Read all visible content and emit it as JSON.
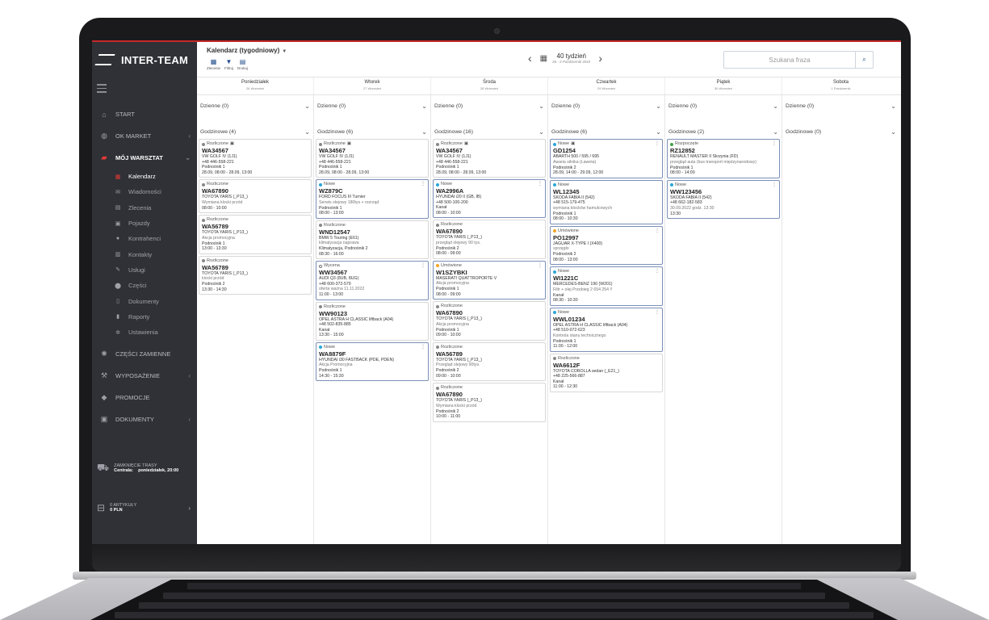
{
  "app": {
    "name": "INTER-TEAM"
  },
  "colors": {
    "accent": "#c62828",
    "sidebar_bg": "#2f3136",
    "primary": "#1e4b8a"
  },
  "sidebar": {
    "items": [
      {
        "label": "START",
        "icon": "home-icon"
      },
      {
        "label": "OK MARKET",
        "icon": "globe-icon"
      },
      {
        "label": "MÓJ WARSZTAT",
        "icon": "car-icon",
        "active": true
      }
    ],
    "sub_items": [
      {
        "label": "Kalendarz",
        "icon": "calendar-icon",
        "active": true
      },
      {
        "label": "Wiadomości",
        "icon": "mail-icon"
      },
      {
        "label": "Zlecenia",
        "icon": "clipboard-icon"
      },
      {
        "label": "Pojazdy",
        "icon": "vehicle-icon"
      },
      {
        "label": "Kontrahenci",
        "icon": "user-icon"
      },
      {
        "label": "Kontakty",
        "icon": "contact-icon"
      },
      {
        "label": "Usługi",
        "icon": "wrench-icon"
      },
      {
        "label": "Części",
        "icon": "part-icon"
      },
      {
        "label": "Dokumenty",
        "icon": "document-icon"
      },
      {
        "label": "Raporty",
        "icon": "chart-icon"
      },
      {
        "label": "Ustawienia",
        "icon": "gear-icon"
      }
    ],
    "bottom_items": [
      {
        "label": "CZĘŚCI ZAMIENNE",
        "icon": "parts-icon"
      },
      {
        "label": "WYPOSAŻENIE",
        "icon": "equipment-icon"
      },
      {
        "label": "PROMOCJE",
        "icon": "tag-icon"
      },
      {
        "label": "DOKUMENTY",
        "icon": "document-icon"
      }
    ],
    "route": {
      "title": "ZAMKNIĘCIE TRASY",
      "label": "Centrala:",
      "value": "poniedziałek, 20:00"
    },
    "cart": {
      "title": "0 ARTYKUŁY",
      "value": "0 PLN"
    }
  },
  "toolbar": {
    "title": "Kalendarz (tygodniowy)",
    "tools": [
      {
        "label": "Zlecenie"
      },
      {
        "label": "Filtruj"
      },
      {
        "label": "Drukuj"
      }
    ],
    "week": "40 tydzień",
    "range": "26 - 2 Październik 2022",
    "search_placeholder": "Szukana fraza"
  },
  "days": [
    {
      "name": "Poniedziałek",
      "date": "26 Wrzesień",
      "dzienne": "Dzienne (0)",
      "godzinowe": "Godzinowe (4)",
      "cards": [
        {
          "status": "Rozliczone",
          "dot": "#888888",
          "plate": "WA34567",
          "car": "VW GOLF IV (1J1)",
          "phone": "+48 446-558-221",
          "desc": "",
          "loc": "Podnośnik 1",
          "time": "28.09, 08:00 - 28.09, 13:00"
        },
        {
          "status": "Rozliczone",
          "dot": "#888888",
          "plate": "WA67890",
          "car": "TOYOTA YARIS (_P13_)",
          "phone": "",
          "desc": "Wymiana klocki przód",
          "loc": "",
          "time": "08:00 - 10:00"
        },
        {
          "status": "Rozliczone",
          "dot": "#888888",
          "plate": "WA56789",
          "car": "TOYOTA YARIS (_P13_)",
          "phone": "",
          "desc": "Akcja promocyjna",
          "loc": "Podnośnik 1",
          "time": "13:00 - 13:30"
        },
        {
          "status": "Rozliczone",
          "dot": "#888888",
          "plate": "WA56789",
          "car": "TOYOTA YARIS (_P13_)",
          "phone": "",
          "desc": "klocki przód",
          "loc": "Podnośnik 2",
          "time": "13:30 - 14:30"
        }
      ]
    },
    {
      "name": "Wtorek",
      "date": "27 Wrzesień",
      "dzienne": "Dzienne (0)",
      "godzinowe": "Godzinowe (6)",
      "cards": [
        {
          "status": "Rozliczone",
          "dot": "#888888",
          "plate": "WA34567",
          "car": "VW GOLF IV (1J1)",
          "phone": "+48 446-558-221",
          "desc": "",
          "loc": "Podnośnik 1",
          "time": "28.09, 08:00 - 28.09, 13:00"
        },
        {
          "status": "Nowe",
          "dot": "#29a7d8",
          "plate": "WZ879C",
          "car": "FORD FOCUS III Turnier",
          "phone": "",
          "desc": "Serwis olejowy 180tys + rozrząd",
          "loc": "Podnośnik 1",
          "time": "08:00 - 13:00",
          "menu": true
        },
        {
          "status": "Rozliczone",
          "dot": "#888888",
          "plate": "WND12547",
          "car": "BMW 5 Touring (E61)",
          "phone": "",
          "desc": "klimatyzacja naprawa",
          "loc": "Klimatyzacja, Podnośnik 2",
          "time": "08:30 - 16:00"
        },
        {
          "status": "Wycena",
          "dot": "#ffffff",
          "plate": "WW34567",
          "car": "AUDI Q3 (8UB, 8UG)",
          "phone": "+48 600-372-579",
          "desc": "oferta ważna 11.11.2022",
          "loc": "",
          "time": "11:00 - 13:00",
          "menu": true
        },
        {
          "status": "Rozliczone",
          "dot": "#888888",
          "plate": "WW90123",
          "car": "OPEL ASTRA H CLASSIC liftback (A04)",
          "phone": "+48 502-835-885",
          "desc": "",
          "loc": "Kanał",
          "time": "13:30 - 15:00"
        },
        {
          "status": "Nowe",
          "dot": "#29a7d8",
          "plate": "WA8879F",
          "car": "HYUNDAI i30 FASTBACK (PDE, PDEN)",
          "phone": "",
          "desc": "Akcja Promocyjna",
          "loc": "Podnośnik 1",
          "time": "14:30 - 15:30",
          "menu": true
        }
      ]
    },
    {
      "name": "Środa",
      "date": "28 Wrzesień",
      "dzienne": "Dzienne (0)",
      "godzinowe": "Godzinowe (16)",
      "cards": [
        {
          "status": "Rozliczone",
          "dot": "#888888",
          "plate": "WA34567",
          "car": "VW GOLF IV (1J1)",
          "phone": "+48 446-558-221",
          "desc": "",
          "loc": "Podnośnik 1",
          "time": "28.09, 08:00 - 28.09, 13:00"
        },
        {
          "status": "Nowe",
          "dot": "#29a7d8",
          "plate": "WA2996A",
          "car": "HYUNDAI i20 II (GB, IB)",
          "phone": "+48 500-100-200",
          "desc": "",
          "loc": "Kanał",
          "time": "08:00 - 10:00",
          "menu": true
        },
        {
          "status": "Rozliczone",
          "dot": "#888888",
          "plate": "WA67890",
          "car": "TOYOTA YARIS (_P13_)",
          "phone": "",
          "desc": "przegląd olejowy 90 tys.",
          "loc": "Podnośnik 2",
          "time": "08:00 - 09:00"
        },
        {
          "status": "Umówione",
          "dot": "#f5a623",
          "plate": "W1SZYBKI",
          "car": "MASERATI QUATTROPORTE V",
          "phone": "",
          "desc": "Akcja promocyjna",
          "loc": "Podnośnik 1",
          "time": "08:00 - 09:00",
          "menu": true
        },
        {
          "status": "Rozliczone",
          "dot": "#888888",
          "plate": "WA67890",
          "car": "TOYOTA YARIS (_P13_)",
          "phone": "",
          "desc": "Akcja promocyjna",
          "loc": "Podnośnik 1",
          "time": "09:00 - 10:00"
        },
        {
          "status": "Rozliczone",
          "dot": "#888888",
          "plate": "WA56789",
          "car": "TOYOTA YARIS (_P13_)",
          "phone": "",
          "desc": "Przegląd olejowy 90tys.",
          "loc": "Podnośnik 2",
          "time": "09:00 - 10:00"
        },
        {
          "status": "Rozliczone",
          "dot": "#888888",
          "plate": "WA67890",
          "car": "TOYOTA YARIS (_P13_)",
          "phone": "",
          "desc": "Wymiana klocki przód",
          "loc": "Podnośnik 2",
          "time": "10:00 - 11:00"
        }
      ]
    },
    {
      "name": "Czwartek",
      "date": "29 Wrzesień",
      "dzienne": "Dzienne (0)",
      "godzinowe": "Godzinowe (6)",
      "cards": [
        {
          "status": "Nowe",
          "dot": "#29a7d8",
          "plate": "GD1254",
          "car": "ABARTH 500 / 595 / 695",
          "phone": "",
          "desc": "Awaria silnika (Laweta)",
          "loc": "Podnośnik 2",
          "time": "28.09, 14:00 - 29.09, 12:00",
          "menu": true
        },
        {
          "status": "Nowe",
          "dot": "#29a7d8",
          "plate": "WL12345",
          "car": "SKODA FABIA II (542)",
          "phone": "+48 515-179-475",
          "desc": "wymiana klocków hamulcowych",
          "loc": "Podnośnik 1",
          "time": "08:00 - 10:30"
        },
        {
          "status": "Umówione",
          "dot": "#f5a623",
          "plate": "PO12997",
          "car": "JAGUAR X-TYPE I (X400)",
          "phone": "",
          "desc": "sprzęgło",
          "loc": "Podnośnik 2",
          "time": "08:00 - 13:00",
          "menu": true
        },
        {
          "status": "Nowe",
          "dot": "#29a7d8",
          "plate": "WI1221C",
          "car": "MERCEDES-BENZ 190 (W201)",
          "phone": "",
          "desc": "Filtr + olej Przebieg 2 654 254 !!",
          "loc": "Kanał",
          "time": "08:30 - 10:30",
          "menu": true
        },
        {
          "status": "Nowe",
          "dot": "#29a7d8",
          "plate": "WWL01234",
          "car": "OPEL ASTRA H CLASSIC liftback (A04)",
          "phone": "+48 510-072-623",
          "desc": "Kontrola stanu technicznego",
          "loc": "Podnośnik 1",
          "time": "11:00 - 12:00",
          "menu": true
        },
        {
          "status": "Rozliczone",
          "dot": "#888888",
          "plate": "WA6612F",
          "car": "TOYOTA COROLLA sedan (_E21_)",
          "phone": "+48 225-566-887",
          "desc": "",
          "loc": "Kanał",
          "time": "11:00 - 12:30"
        }
      ]
    },
    {
      "name": "Piątek",
      "date": "30 Wrzesień",
      "dzienne": "Dzienne (0)",
      "godzinowe": "Godzinowe (2)",
      "cards": [
        {
          "status": "Rozpoczęte",
          "dot": "#43a047",
          "plate": "RZ12852",
          "car": "RENAULT MASTER II Skrzynia (FD)",
          "phone": "",
          "desc": "przegląd auta (bus transport międzynarodowy)",
          "loc": "Podnośnik 1",
          "time": "08:00 - 14:00",
          "menu": true
        },
        {
          "status": "Nowe",
          "dot": "#29a7d8",
          "plate": "WW123456",
          "car": "SKODA FABIA II (542)",
          "phone": "+48 662-182-583",
          "desc": "30.09.2022 godz. 13:30",
          "loc": "",
          "time": "13:30",
          "menu": true
        }
      ]
    },
    {
      "name": "Sobota",
      "date": "1 Październik",
      "dzienne": "Dzienne (0)",
      "godzinowe": "Godzinowe (0)",
      "cards": []
    }
  ]
}
